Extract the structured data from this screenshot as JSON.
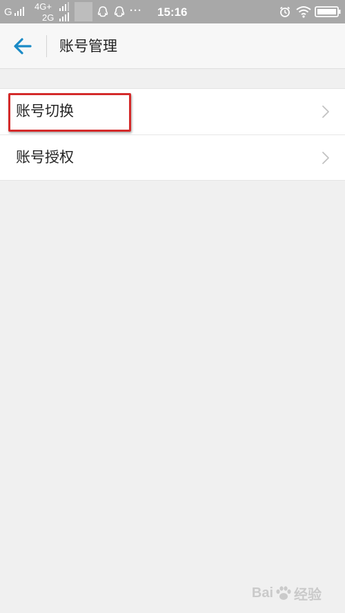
{
  "status_bar": {
    "carrier1": "G",
    "carrier2_top": "4G+",
    "carrier2_bottom": "2G",
    "more": "···",
    "time": "15:16"
  },
  "toolbar": {
    "back_icon": "arrow-left-icon",
    "title": "账号管理"
  },
  "menu": {
    "items": [
      {
        "label": "账号切换",
        "icon": "chevron-right-icon"
      },
      {
        "label": "账号授权",
        "icon": "chevron-right-icon"
      }
    ]
  },
  "watermark": {
    "brand": "Bai",
    "suffix": "经验"
  },
  "colors": {
    "status_bar_bg": "#a8a8a8",
    "accent": "#1a8ac6",
    "highlight": "#d42a2a",
    "page_bg": "#f0f0f0"
  }
}
